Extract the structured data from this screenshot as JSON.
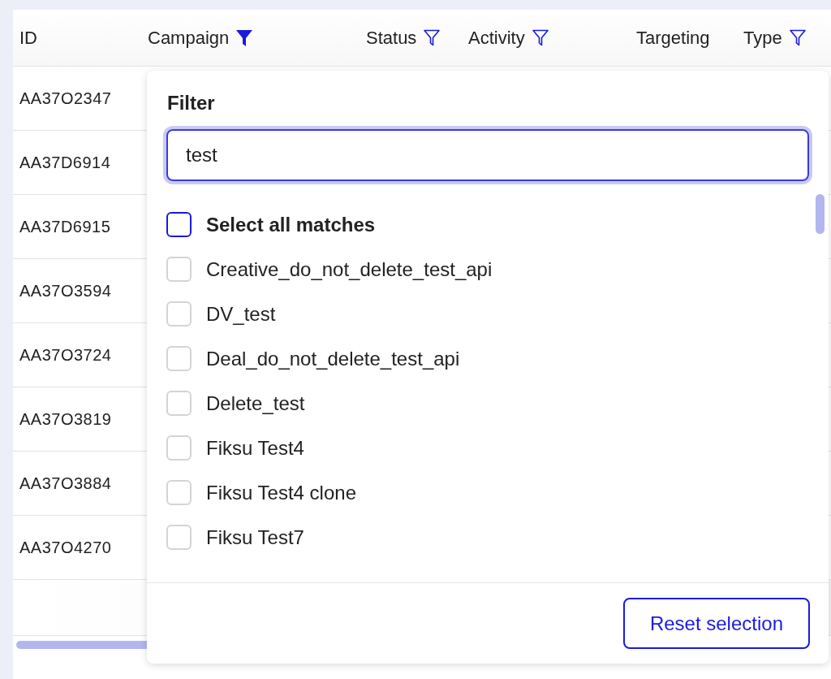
{
  "table": {
    "columns": [
      {
        "label": "ID",
        "kind": "plain"
      },
      {
        "label": "Campaign",
        "kind": "filterable",
        "filtered": true
      },
      {
        "label": "Status",
        "kind": "filterable",
        "filtered": false
      },
      {
        "label": "Activity",
        "kind": "filterable",
        "filtered": false
      },
      {
        "label": "Targeting",
        "kind": "plain"
      },
      {
        "label": "Type",
        "kind": "filterable",
        "filtered": false
      }
    ],
    "rows": [
      {
        "id": "AA37O2347"
      },
      {
        "id": "AA37D6914"
      },
      {
        "id": "AA37D6915"
      },
      {
        "id": "AA37O3594"
      },
      {
        "id": "AA37O3724"
      },
      {
        "id": "AA37O3819"
      },
      {
        "id": "AA37O3884"
      },
      {
        "id": "AA37O4270"
      }
    ]
  },
  "filter_popover": {
    "title": "Filter",
    "search_value": "test",
    "options": [
      {
        "label": "Select all matches",
        "kind": "select-all",
        "checked": false
      },
      {
        "label": "Creative_do_not_delete_test_api",
        "kind": "option",
        "checked": false
      },
      {
        "label": "DV_test",
        "kind": "option",
        "checked": false
      },
      {
        "label": "Deal_do_not_delete_test_api",
        "kind": "option",
        "checked": false
      },
      {
        "label": "Delete_test",
        "kind": "option",
        "checked": false
      },
      {
        "label": "Fiksu Test4",
        "kind": "option",
        "checked": false
      },
      {
        "label": "Fiksu Test4 clone",
        "kind": "option",
        "checked": false
      },
      {
        "label": "Fiksu Test7",
        "kind": "option",
        "checked": false
      }
    ],
    "button": "Reset selection"
  }
}
